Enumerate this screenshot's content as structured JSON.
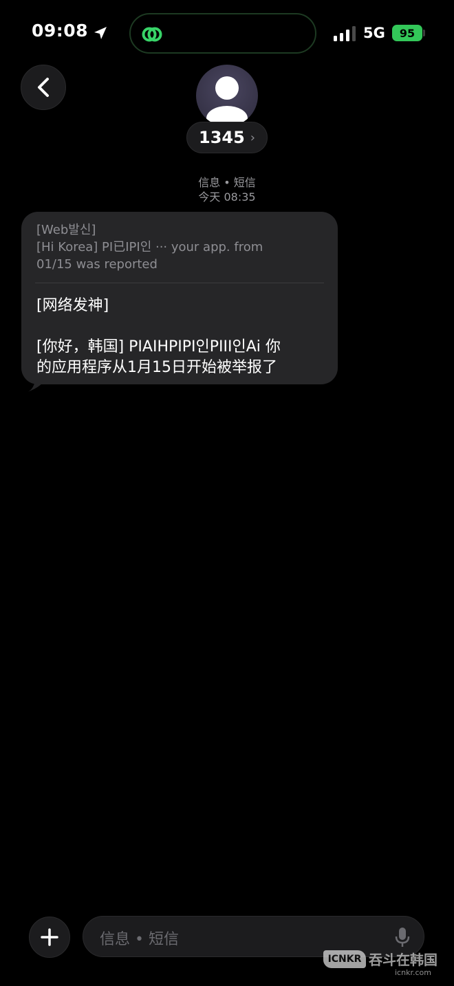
{
  "status_bar": {
    "time": "09:08",
    "network": "5G",
    "battery": "95",
    "accent_color": "#33c759"
  },
  "header": {
    "contact_name": "1345",
    "chevron": "›",
    "icons": [
      "back-chevron-icon",
      "person-avatar-icon"
    ]
  },
  "thread": {
    "service_label": "信息 • 短信",
    "timestamp": "今天 08:35"
  },
  "message": {
    "original_lines": [
      "[Web발신]",
      "[Hi Korea] PI已IPI인 ··· your app. from",
      "01/15 was reported"
    ],
    "translation_line1": "[网络发神]",
    "translation_line2": "[你好，韩国] PIAIHPIPI인PIII인Ai 你",
    "translation_line3": "的应用程序从1月15日开始被举报了"
  },
  "composer": {
    "placeholder": "信息 • 短信",
    "icons": [
      "plus-icon",
      "microphone-icon"
    ]
  },
  "watermark": {
    "logo": "ICNKR",
    "title": "吞斗在韩国",
    "url": "icnkr.com"
  }
}
